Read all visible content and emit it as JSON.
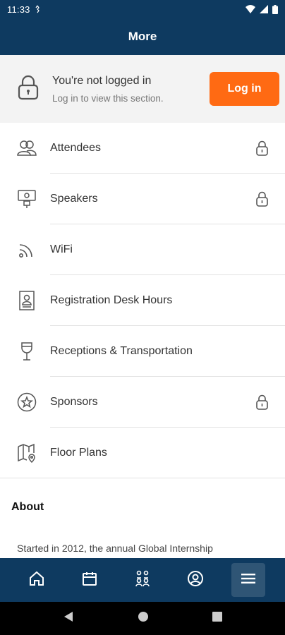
{
  "status_bar": {
    "time": "11:33"
  },
  "app_bar": {
    "title": "More"
  },
  "login_card": {
    "title": "You're not logged in",
    "subtitle": "Log in to view this section.",
    "button_label": "Log in"
  },
  "menu": {
    "items": [
      {
        "label": "Attendees",
        "icon": "attendees-icon",
        "locked": true
      },
      {
        "label": "Speakers",
        "icon": "speaker-icon",
        "locked": true
      },
      {
        "label": "WiFi",
        "icon": "wifi-icon",
        "locked": false
      },
      {
        "label": "Registration Desk Hours",
        "icon": "badge-icon",
        "locked": false
      },
      {
        "label": "Receptions & Transportation",
        "icon": "wine-glass-icon",
        "locked": false
      },
      {
        "label": "Sponsors",
        "icon": "star-icon",
        "locked": true
      },
      {
        "label": "Floor Plans",
        "icon": "map-icon",
        "locked": false
      }
    ]
  },
  "about": {
    "title": "About",
    "text": "Started in 2012, the annual Global Internship"
  },
  "bottom_nav": {
    "items": [
      {
        "icon": "home-icon"
      },
      {
        "icon": "calendar-icon"
      },
      {
        "icon": "people-icon"
      },
      {
        "icon": "profile-icon"
      },
      {
        "icon": "menu-icon",
        "active": true
      }
    ]
  },
  "colors": {
    "primary": "#0e3a60",
    "accent": "#ff6a13",
    "card_bg": "#f3f3f3"
  }
}
